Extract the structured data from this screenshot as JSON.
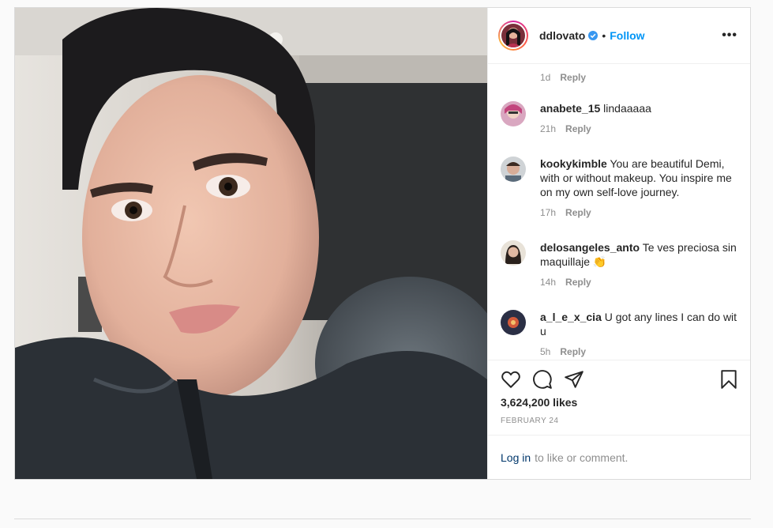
{
  "header": {
    "username": "ddlovato",
    "separator": "•",
    "follow_label": "Follow",
    "more_label": "•••",
    "verified_color": "#3897f0"
  },
  "comments": {
    "top_meta": {
      "time": "1d",
      "reply": "Reply"
    },
    "items": [
      {
        "user": "anabete_15",
        "text": "lindaaaaa",
        "time": "21h",
        "reply": "Reply"
      },
      {
        "user": "kookykimble",
        "text": "You are beautiful Demi, with or without makeup. You inspire me on my own self-love journey.",
        "time": "17h",
        "reply": "Reply"
      },
      {
        "user": "delosangeles_anto",
        "text": "Te ves preciosa sin maquillaje 👏",
        "time": "14h",
        "reply": "Reply"
      },
      {
        "user": "a_l_e_x_cia",
        "text": "U got any lines I can do wit u",
        "time": "5h",
        "reply": "Reply"
      }
    ]
  },
  "actions": {
    "icons": [
      "heart-icon",
      "comment-icon",
      "share-icon",
      "bookmark-icon"
    ],
    "likes": "3,624,200 likes",
    "date": "FEBRUARY 24"
  },
  "login": {
    "link": "Log in",
    "text": "to like or comment."
  }
}
